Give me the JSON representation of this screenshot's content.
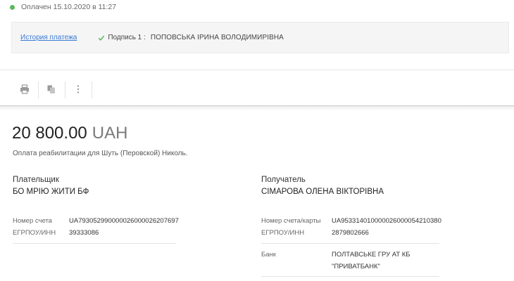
{
  "status": {
    "text": "Оплачен 15.10.2020 в 11:27",
    "color": "#5cb85c"
  },
  "info": {
    "history_link": "История платежа",
    "signature_label": "Подпись 1 :",
    "signature_name": "ПОПОВСЬКА ІРИНА ВОЛОДИМИРІВНА"
  },
  "toolbar": {
    "icons": [
      "printer-icon",
      "copy-icon",
      "more-vertical-icon"
    ]
  },
  "payment": {
    "amount": "20 800.00",
    "currency": "UAH",
    "purpose": "Оплата реабилитации для Шуть (Перовской) Николь."
  },
  "payer": {
    "heading": "Плательщик",
    "name": "БО МРІЮ ЖИТИ БФ",
    "account_label": "Номер счета",
    "account_value": "UA793052990000026000026207697",
    "edrpou_label": "ЕГРПОУ/ИНН",
    "edrpou_value": "39333086"
  },
  "recipient": {
    "heading": "Получатель",
    "name": "СІМАРОВА ОЛЕНА ВІКТОРІВНА",
    "account_label": "Номер счета/карты",
    "account_value": "UA953314010000026000054210380",
    "edrpou_label": "ЕГРПОУ/ИНН",
    "edrpou_value": "2879802666",
    "bank_label": "Банк",
    "bank_value_line1": "ПОЛТАВСЬКЕ ГРУ АТ КБ",
    "bank_value_line2": "\"ПРИВАТБАНК\""
  }
}
